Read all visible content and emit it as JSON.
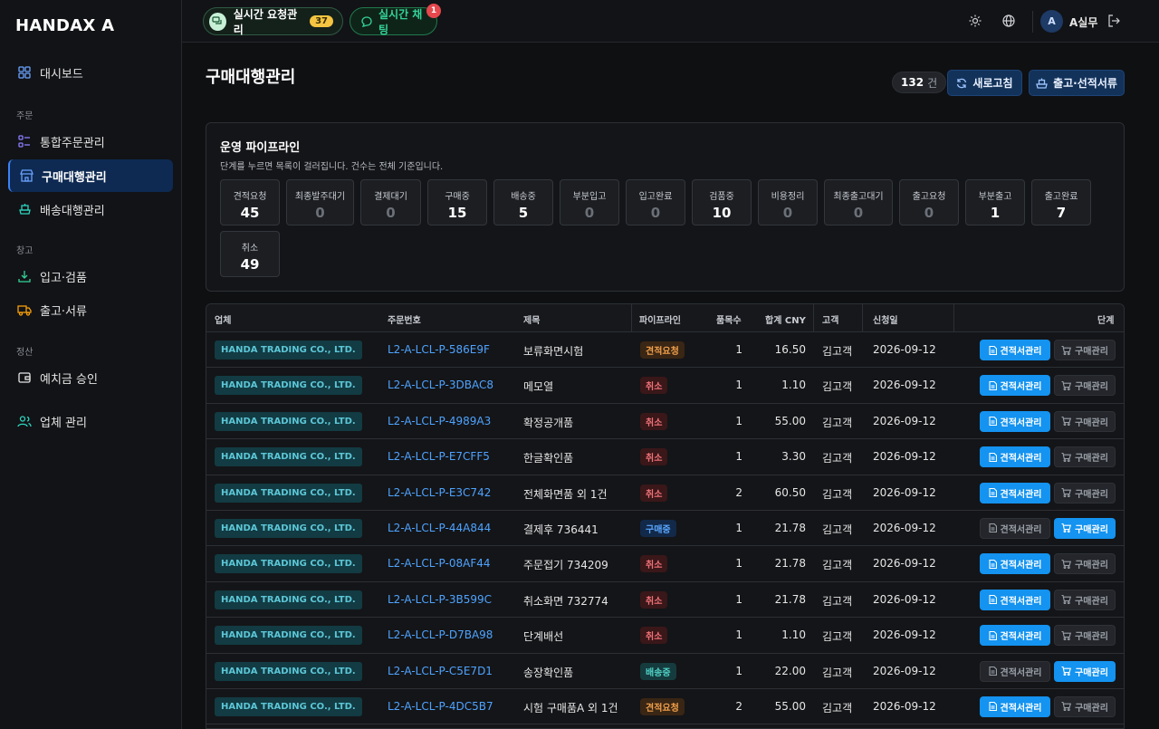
{
  "app": {
    "title": "HANDAX A"
  },
  "sidebar": {
    "dashboard": "대시보드",
    "section_order": "주문",
    "order_integrated": "통합주문관리",
    "purchase_agency": "구매대행관리",
    "shipping_agency": "배송대행관리",
    "section_warehouse": "창고",
    "inbound": "입고·검품",
    "outbound": "출고·서류",
    "section_settlement": "정산",
    "deposit_approval": "예치금 승인",
    "vendor_mgmt": "업체 관리"
  },
  "topbar": {
    "realtime_requests": "실시간 요청관리",
    "realtime_requests_count": "37",
    "realtime_chat": "실시간 채팅",
    "chat_badge": "1",
    "avatar_initial": "A",
    "user_name": "A실무"
  },
  "page": {
    "title": "구매대행관리",
    "count_value": "132",
    "count_unit": "건",
    "refresh_label": "새로고침",
    "outbound_docs_label": "출고·선적서류"
  },
  "pipeline": {
    "title": "운영 파이프라인",
    "description": "단계를 누르면 목록이 걸러집니다. 건수는 전체 기준입니다.",
    "stages": [
      {
        "label": "견적요청",
        "count": "45"
      },
      {
        "label": "최종발주대기",
        "count": "0"
      },
      {
        "label": "결제대기",
        "count": "0"
      },
      {
        "label": "구매중",
        "count": "15"
      },
      {
        "label": "배송중",
        "count": "5"
      },
      {
        "label": "부분입고",
        "count": "0"
      },
      {
        "label": "입고완료",
        "count": "0"
      },
      {
        "label": "검품중",
        "count": "10"
      },
      {
        "label": "비용정리",
        "count": "0"
      },
      {
        "label": "최종출고대기",
        "count": "0"
      },
      {
        "label": "출고요청",
        "count": "0"
      },
      {
        "label": "부분출고",
        "count": "1"
      },
      {
        "label": "출고완료",
        "count": "7"
      },
      {
        "label": "취소",
        "count": "49"
      }
    ]
  },
  "table": {
    "headers": {
      "vendor": "업체",
      "order_no": "주문번호",
      "product": "제목",
      "pipeline": "파이프라인",
      "item_count": "품목수",
      "total_cny": "합계 CNY",
      "customer": "고객",
      "request_date": "신청일",
      "stage": "단계"
    },
    "action_quote": "견적서관리",
    "action_purchase": "구매관리",
    "rows": [
      {
        "vendor": "HANDA TRADING CO., LTD.",
        "order_no": "L2-A-LCL-P-586E9F",
        "product": "보류화면시험",
        "pipeline": "견적요청",
        "items": "1",
        "total": "16.50",
        "customer": "김고객",
        "date": "2026-09-12",
        "active": "quote"
      },
      {
        "vendor": "HANDA TRADING CO., LTD.",
        "order_no": "L2-A-LCL-P-3DBAC8",
        "product": "메모열",
        "pipeline": "취소",
        "items": "1",
        "total": "1.10",
        "customer": "김고객",
        "date": "2026-09-12",
        "active": "quote"
      },
      {
        "vendor": "HANDA TRADING CO., LTD.",
        "order_no": "L2-A-LCL-P-4989A3",
        "product": "확정공개품",
        "pipeline": "취소",
        "items": "1",
        "total": "55.00",
        "customer": "김고객",
        "date": "2026-09-12",
        "active": "quote"
      },
      {
        "vendor": "HANDA TRADING CO., LTD.",
        "order_no": "L2-A-LCL-P-E7CFF5",
        "product": "한글확인품",
        "pipeline": "취소",
        "items": "1",
        "total": "3.30",
        "customer": "김고객",
        "date": "2026-09-12",
        "active": "quote"
      },
      {
        "vendor": "HANDA TRADING CO., LTD.",
        "order_no": "L2-A-LCL-P-E3C742",
        "product": "전체화면품 외 1건",
        "pipeline": "취소",
        "items": "2",
        "total": "60.50",
        "customer": "김고객",
        "date": "2026-09-12",
        "active": "quote"
      },
      {
        "vendor": "HANDA TRADING CO., LTD.",
        "order_no": "L2-A-LCL-P-44A844",
        "product": "결제후 736441",
        "pipeline": "구매중",
        "items": "1",
        "total": "21.78",
        "customer": "김고객",
        "date": "2026-09-12",
        "active": "purchase"
      },
      {
        "vendor": "HANDA TRADING CO., LTD.",
        "order_no": "L2-A-LCL-P-08AF44",
        "product": "주문접기 734209",
        "pipeline": "취소",
        "items": "1",
        "total": "21.78",
        "customer": "김고객",
        "date": "2026-09-12",
        "active": "quote"
      },
      {
        "vendor": "HANDA TRADING CO., LTD.",
        "order_no": "L2-A-LCL-P-3B599C",
        "product": "취소화면 732774",
        "pipeline": "취소",
        "items": "1",
        "total": "21.78",
        "customer": "김고객",
        "date": "2026-09-12",
        "active": "quote"
      },
      {
        "vendor": "HANDA TRADING CO., LTD.",
        "order_no": "L2-A-LCL-P-D7BA98",
        "product": "단계배선",
        "pipeline": "취소",
        "items": "1",
        "total": "1.10",
        "customer": "김고객",
        "date": "2026-09-12",
        "active": "quote"
      },
      {
        "vendor": "HANDA TRADING CO., LTD.",
        "order_no": "L2-A-LCL-P-C5E7D1",
        "product": "송장확인품",
        "pipeline": "배송중",
        "items": "1",
        "total": "22.00",
        "customer": "김고객",
        "date": "2026-09-12",
        "active": "purchase"
      },
      {
        "vendor": "HANDA TRADING CO., LTD.",
        "order_no": "L2-A-LCL-P-4DC5B7",
        "product": "시험 구매품A 외 1건",
        "pipeline": "견적요청",
        "items": "2",
        "total": "55.00",
        "customer": "김고객",
        "date": "2026-09-12",
        "active": "quote"
      }
    ]
  },
  "colors": {
    "accent": "#1493f0",
    "sidebar_active": "#0e2a52",
    "success": "#34d399"
  }
}
